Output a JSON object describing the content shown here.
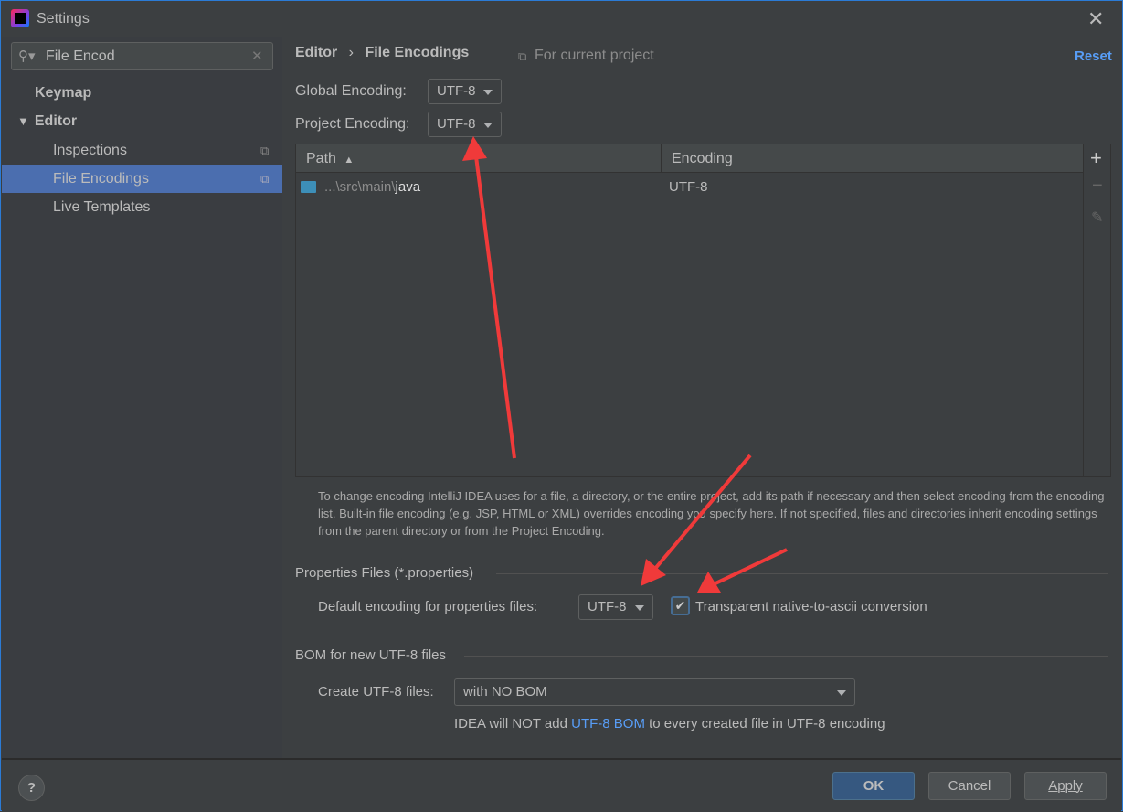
{
  "window": {
    "title": "Settings"
  },
  "sidebar": {
    "search_value": "File Encod",
    "items": [
      {
        "label": "Keymap"
      },
      {
        "label": "Editor"
      },
      {
        "label": "Inspections"
      },
      {
        "label": "File Encodings"
      },
      {
        "label": "Live Templates"
      }
    ]
  },
  "breadcrumb": {
    "parent": "Editor",
    "current": "File Encodings",
    "scope": "For current project",
    "reset": "Reset"
  },
  "global_encoding": {
    "label": "Global Encoding:",
    "value": "UTF-8"
  },
  "project_encoding": {
    "label": "Project Encoding:",
    "value": "UTF-8"
  },
  "table": {
    "columns": [
      "Path",
      "Encoding"
    ],
    "rows": [
      {
        "path_prefix": "...\\src\\main\\",
        "path_last": "java",
        "encoding": "UTF-8"
      }
    ]
  },
  "help_text": "To change encoding IntelliJ IDEA uses for a file, a directory, or the entire project, add its path if necessary and then select encoding from the encoding list. Built-in file encoding (e.g. JSP, HTML or XML) overrides encoding you specify here. If not specified, files and directories inherit encoding settings from the parent directory or from the Project Encoding.",
  "properties": {
    "title": "Properties Files (*.properties)",
    "label": "Default encoding for properties files:",
    "value": "UTF-8",
    "checkbox_label": "Transparent native-to-ascii conversion",
    "checked": true
  },
  "bom": {
    "title": "BOM for new UTF-8 files",
    "label": "Create UTF-8 files:",
    "value": "with NO BOM",
    "note_before": "IDEA will NOT add ",
    "note_link": "UTF-8 BOM",
    "note_after": " to every created file in UTF-8 encoding"
  },
  "footer": {
    "help": "?",
    "ok": "OK",
    "cancel": "Cancel",
    "apply": "Apply"
  },
  "colors": {
    "accent": "#4b6eaf",
    "link": "#589df6",
    "annotation_arrow": "#f03a3a"
  }
}
